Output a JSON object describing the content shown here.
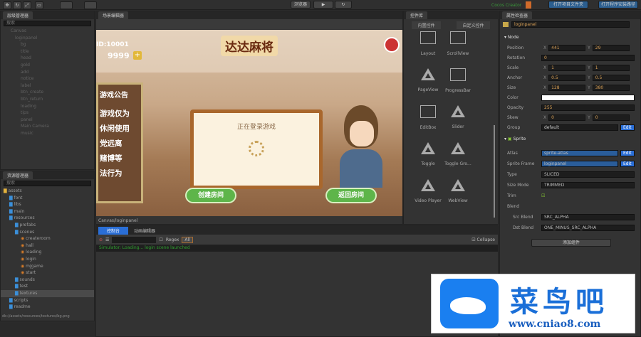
{
  "toolbar": {
    "platform": "浏览器",
    "play": "▶",
    "refresh": "↻",
    "version": "Cocos Creator",
    "open_project": "打开项目文件夹",
    "open_install": "打开程序安装路径"
  },
  "hierarchy": {
    "title": "层级管理器",
    "search_placeholder": "搜索",
    "items": [
      "Canvas",
      "loginpanel",
      "bg",
      "title",
      "head",
      "gold",
      "add",
      "notice",
      "label",
      "btn_create",
      "btn_return",
      "loading",
      "tips",
      "panel",
      "Main Camera",
      "music"
    ]
  },
  "assets": {
    "title": "资源管理器",
    "search_placeholder": "搜索",
    "items": [
      {
        "name": "assets",
        "d": 0
      },
      {
        "name": "font",
        "d": 1
      },
      {
        "name": "libs",
        "d": 1
      },
      {
        "name": "main",
        "d": 1
      },
      {
        "name": "resources",
        "d": 1
      },
      {
        "name": "prefabs",
        "d": 2
      },
      {
        "name": "scenes",
        "d": 2
      },
      {
        "name": "createroom",
        "d": 3
      },
      {
        "name": "hall",
        "d": 3
      },
      {
        "name": "loading",
        "d": 3
      },
      {
        "name": "login",
        "d": 3
      },
      {
        "name": "mjgame",
        "d": 3
      },
      {
        "name": "start",
        "d": 3
      },
      {
        "name": "sounds",
        "d": 2
      },
      {
        "name": "test",
        "d": 2
      },
      {
        "name": "textures",
        "d": 2
      },
      {
        "name": "scripts",
        "d": 1
      },
      {
        "name": "readme",
        "d": 1
      }
    ],
    "status": "db://assets/resources/textures/bg.png"
  },
  "scene": {
    "title": "场景编辑器",
    "path": "Canvas/loginpanel",
    "game": {
      "title": "达达麻将",
      "id": "ID:10001",
      "gold": "9999",
      "notice_title": "游戏公告",
      "notice_lines": [
        "游戏仅为",
        "休闲使用",
        "党远离",
        "赌博等",
        "法行为"
      ],
      "dialog_text": "正在登录游戏",
      "btn_create": "创建房间",
      "btn_return": "返回房间"
    }
  },
  "widgets": {
    "title": "控件库",
    "tabs": [
      "内置控件",
      "自定义控件"
    ],
    "items": [
      "Layout",
      "ScrollView",
      "PageView",
      "ProgressBar",
      "EditBox",
      "Slider",
      "Toggle",
      "Toggle Gro...",
      "Video Player",
      "WebView"
    ]
  },
  "console": {
    "tabs": [
      "控制台",
      "动画编辑器"
    ],
    "regex": "Regex",
    "level": "All",
    "collapse": "Collapse",
    "log": "Simulator: Loading...  login scene launched"
  },
  "inspector": {
    "title": "属性检查器",
    "node_name": "loginpanel",
    "node_section": "Node",
    "rows": [
      {
        "label": "Position",
        "x": "441",
        "y": "29"
      },
      {
        "label": "Rotation",
        "v": "0"
      },
      {
        "label": "Scale",
        "x": "1",
        "y": "1"
      },
      {
        "label": "Anchor",
        "x": "0.5",
        "y": "0.5"
      },
      {
        "label": "Size",
        "x": "128",
        "y": "380"
      },
      {
        "label": "Color",
        "v": ""
      },
      {
        "label": "Opacity",
        "v": "255"
      },
      {
        "label": "Skew",
        "x": "0",
        "y": "0"
      },
      {
        "label": "Group",
        "v": "default"
      }
    ],
    "edit": "Edit",
    "sprite_section": "Sprite",
    "sprite_rows": [
      {
        "label": "Atlas",
        "v": "sprite-atlas"
      },
      {
        "label": "Sprite Frame",
        "v": "loginpanel"
      },
      {
        "label": "Type",
        "v": "SLICED"
      },
      {
        "label": "Size Mode",
        "v": "TRIMMED"
      },
      {
        "label": "Trim",
        "v": ""
      },
      {
        "label": "Blend",
        "v": ""
      },
      {
        "label": "Src Blend",
        "v": "SRC_ALPHA"
      },
      {
        "label": "Dst Blend",
        "v": "ONE_MINUS_SRC_ALPHA"
      }
    ],
    "add_component": "添加组件"
  },
  "watermark": {
    "name": "菜鸟吧",
    "url": "www.cniao8.com"
  }
}
